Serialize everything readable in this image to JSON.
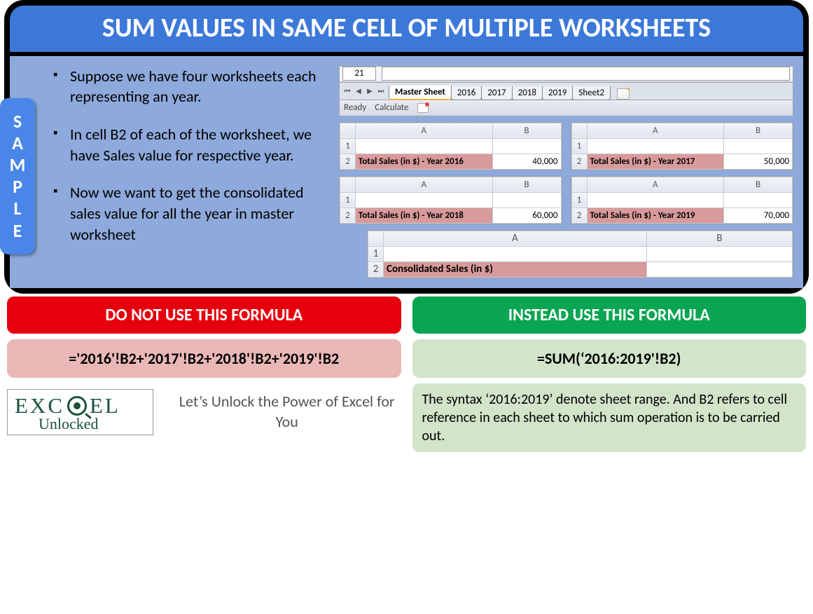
{
  "title": "SUM VALUES IN SAME CELL OF MULTIPLE WORKSHEETS",
  "sample_label": [
    "S",
    "A",
    "M",
    "P",
    "L",
    "E"
  ],
  "bullets": [
    "Suppose we have four worksheets each representing an year.",
    "In cell B2 of each of the worksheet, we have Sales value for respective year.",
    "Now we want to get the consolidated sales value for all the year in master worksheet"
  ],
  "tabbar": {
    "name_box": "21",
    "tabs": [
      "Master Sheet",
      "2016",
      "2017",
      "2018",
      "2019",
      "Sheet2"
    ],
    "active_tab": "Master Sheet",
    "status": [
      "Ready",
      "Calculate"
    ]
  },
  "mini_grids": [
    {
      "label": "Total Sales (in $) - Year 2016",
      "value": "40,000"
    },
    {
      "label": "Total Sales (in $) - Year 2017",
      "value": "50,000"
    },
    {
      "label": "Total Sales (in $) - Year 2018",
      "value": "60,000"
    },
    {
      "label": "Total Sales (in $) - Year 2019",
      "value": "70,000"
    }
  ],
  "wide_grid": {
    "label": "Consolidated Sales (in $)",
    "value": ""
  },
  "headers": {
    "A": "A",
    "B": "B",
    "r1": "1",
    "r2": "2"
  },
  "left": {
    "banner": "DO NOT USE THIS FORMULA",
    "formula": "='2016'!B2+'2017'!B2+'2018'!B2+'2019'!B2"
  },
  "right": {
    "banner": "INSTEAD USE THIS FORMULA",
    "formula": "=SUM(‘2016:2019'!B2)",
    "explain": "The syntax ‘2016:2019’ denote sheet range. And B2 refers to cell reference in each sheet to which sum operation is to be carried out."
  },
  "logo": {
    "top1": "EXC",
    "top2": "EL",
    "bottom": "Unlocked"
  },
  "tagline": "Let’s Unlock the Power of Excel for You"
}
